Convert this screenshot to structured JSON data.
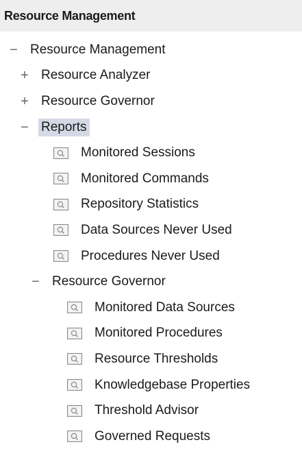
{
  "header": {
    "title": "Resource Management"
  },
  "tree": {
    "root": {
      "toggle": "−",
      "label": "Resource Management"
    },
    "analyzer": {
      "toggle": "+",
      "label": "Resource Analyzer"
    },
    "governor_collapsed": {
      "toggle": "+",
      "label": "Resource Governor"
    },
    "reports": {
      "toggle": "−",
      "label": "Reports",
      "items": [
        "Monitored Sessions",
        "Monitored Commands",
        "Repository Statistics",
        "Data Sources Never Used",
        "Procedures Never Used"
      ]
    },
    "governor": {
      "toggle": "−",
      "label": "Resource Governor",
      "items": [
        "Monitored Data Sources",
        "Monitored Procedures",
        "Resource Thresholds",
        "Knowledgebase Properties",
        "Threshold Advisor",
        "Governed Requests"
      ]
    }
  },
  "icons": {
    "expanded": "minus-toggle-icon",
    "collapsed": "plus-toggle-icon",
    "report": "report-magnifier-icon"
  },
  "colors": {
    "header_bg": "#eeeeee",
    "selection_bg": "#d4d9e6",
    "icon_border": "#8c8c8c",
    "icon_fill": "#e6e6e6"
  }
}
